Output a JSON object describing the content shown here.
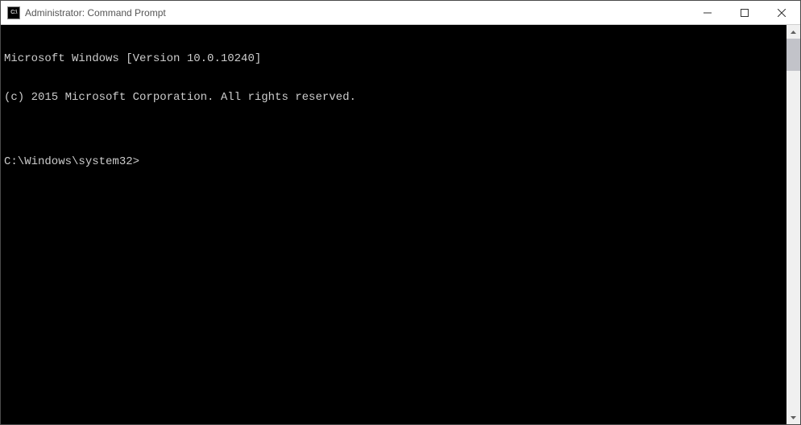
{
  "titlebar": {
    "icon_label": "C:\\",
    "title": "Administrator: Command Prompt"
  },
  "terminal": {
    "lines": [
      "Microsoft Windows [Version 10.0.10240]",
      "(c) 2015 Microsoft Corporation. All rights reserved.",
      "",
      "C:\\Windows\\system32>"
    ]
  }
}
